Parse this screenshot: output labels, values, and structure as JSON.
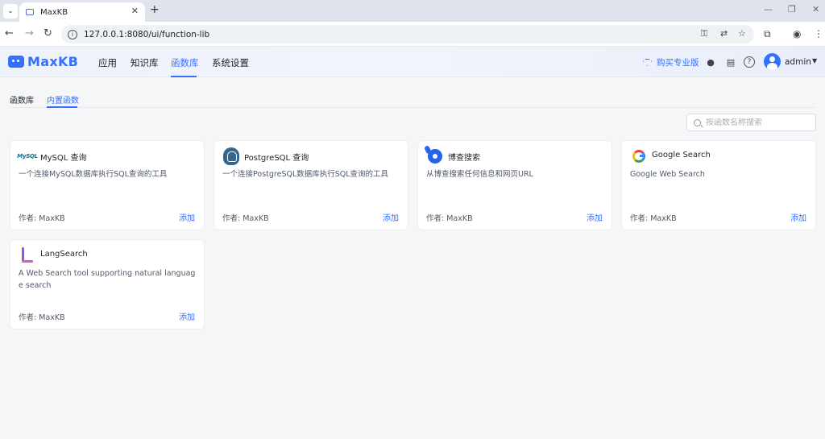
{
  "browser": {
    "tab_title": "MaxKB",
    "url": "127.0.0.1:8080/ui/function-lib"
  },
  "app": {
    "logo_text": "MaxKB",
    "nav": [
      "应用",
      "知识库",
      "函数库",
      "系统设置"
    ],
    "active_nav": "函数库",
    "buy_label": "购买专业版",
    "user_name": "admin"
  },
  "subtabs": [
    "函数库",
    "内置函数"
  ],
  "active_subtab": "内置函数",
  "search": {
    "placeholder": "按函数名称搜索"
  },
  "cards": [
    {
      "icon": "mysql-icon",
      "title": "MySQL 查询",
      "desc": "一个连接MySQL数据库执行SQL查询的工具",
      "author": "作者: MaxKB",
      "action": "添加"
    },
    {
      "icon": "postgresql-icon",
      "title": "PostgreSQL 查询",
      "desc": "一个连接PostgreSQL数据库执行SQL查询的工具",
      "author": "作者: MaxKB",
      "action": "添加"
    },
    {
      "icon": "bocha-icon",
      "title": "博查搜索",
      "desc": "从博查搜索任何信息和网页URL",
      "author": "作者: MaxKB",
      "action": "添加"
    },
    {
      "icon": "google-icon",
      "title": "Google Search",
      "desc": "Google Web Search",
      "author": "作者: MaxKB",
      "action": "添加"
    },
    {
      "icon": "langsearch-icon",
      "title": "LangSearch",
      "desc": "A Web Search tool supporting natural language search",
      "author": "作者: MaxKB",
      "action": "添加"
    }
  ],
  "colors": {
    "accent": "#3370ff",
    "background": "#f5f6f7"
  }
}
